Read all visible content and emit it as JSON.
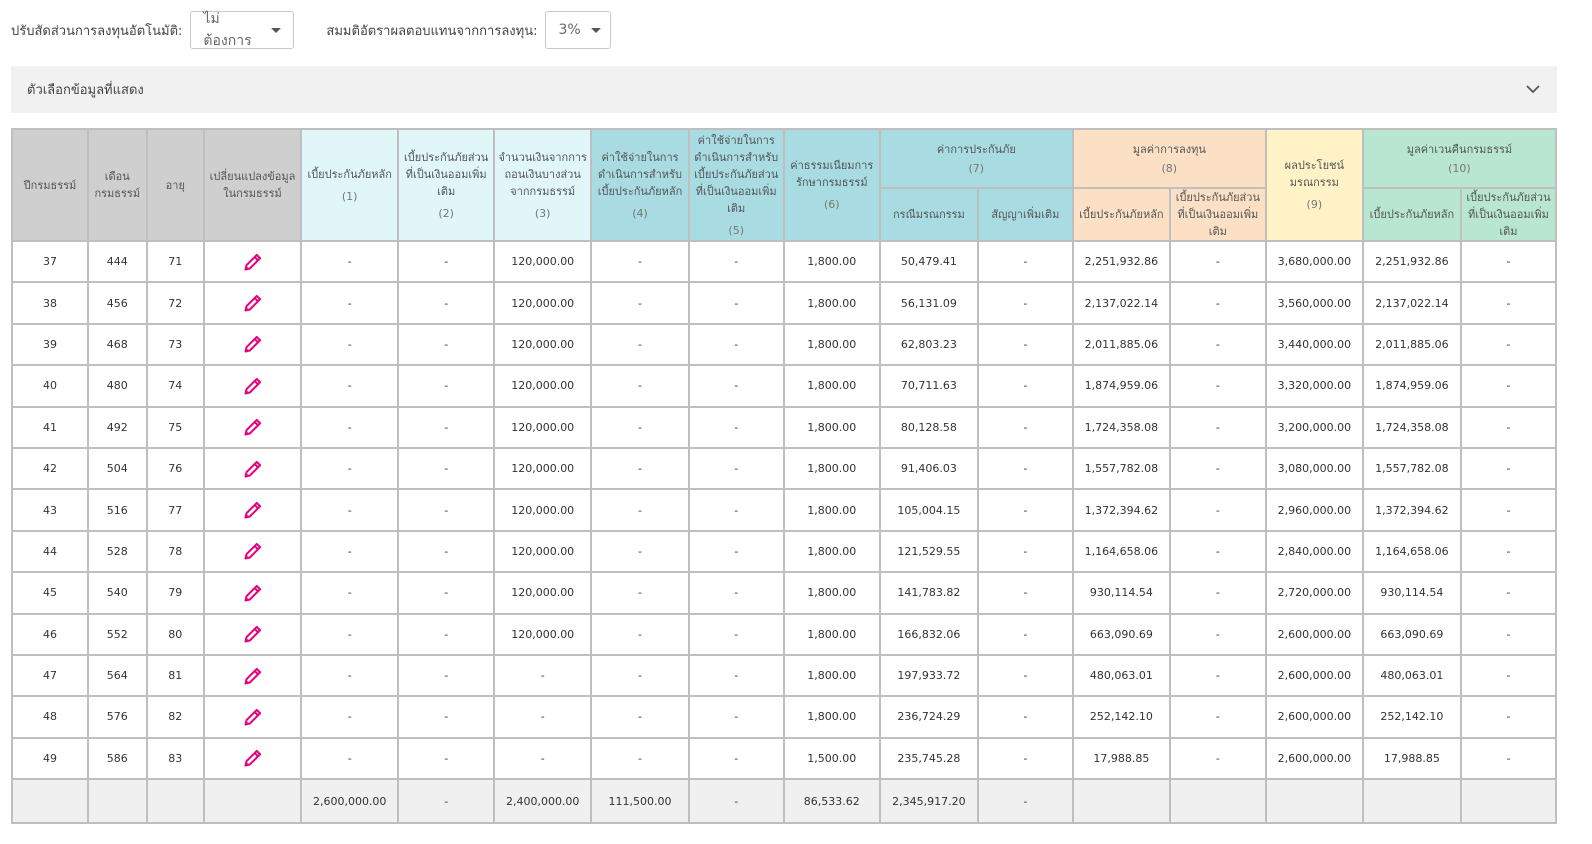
{
  "controls": {
    "auto_rebalance_label": "ปรับสัดส่วนการลงทุนอัตโนมัติ:",
    "auto_rebalance_value": "ไม่ต้องการ",
    "return_rate_label": "สมมติอัตราผลตอบแทนจากการลงทุน:",
    "return_rate_value": "3%"
  },
  "display_options": {
    "title": "ตัวเลือกข้อมูลที่แสดง"
  },
  "colors": {
    "pencil": "#e6007e",
    "header_grey": "#cfcfcf",
    "header_light_cyan": "#e0f6f8",
    "header_cyan": "#a8dce2",
    "header_peach": "#fbe0c6",
    "header_yellow": "#fff2c6",
    "header_green": "#b8e6d0"
  },
  "table": {
    "headers": {
      "policy_year": "ปีกรมธรรม์",
      "policy_month": "เดือนกรมธรรม์",
      "age": "อายุ",
      "change": "เปลี่ยนแปลงข้อมูลในกรมธรรม์",
      "c1": "เบี้ยประกันภัยหลัก",
      "c1_num": "(1)",
      "c2": "เบี้ยประกันภัยส่วนที่เป็นเงินออมเพิ่มเติม",
      "c2_num": "(2)",
      "c3": "จำนวนเงินจากการถอนเงินบางส่วนจากกรมธรรม์",
      "c3_num": "(3)",
      "c4": "ค่าใช้จ่ายในการดำเนินการสำหรับเบี้ยประกันภัยหลัก",
      "c4_num": "(4)",
      "c5": "ค่าใช้จ่ายในการดำเนินการสำหรับเบี้ยประกันภัยส่วนที่เป็นเงินออมเพิ่มเติม",
      "c5_num": "(5)",
      "c6": "ค่าธรรมเนียมการรักษากรมธรรม์",
      "c6_num": "(6)",
      "c7": "ค่าการประกันภัย",
      "c7_num": "(7)",
      "c7a": "กรณีมรณกรรม",
      "c7b": "สัญญาเพิ่มเติม",
      "c8": "มูลค่าการลงทุน",
      "c8_num": "(8)",
      "c8a": "เบี้ยประกันภัยหลัก",
      "c8b": "เบี้ยประกันภัยส่วนที่เป็นเงินออมเพิ่มเติม",
      "c9": "ผลประโยชน์มรณกรรม",
      "c9_num": "(9)",
      "c10": "มูลค่าเวนคืนกรมธรรม์",
      "c10_num": "(10)",
      "c10a": "เบี้ยประกันภัยหลัก",
      "c10b": "เบี้ยประกันภัยส่วนที่เป็นเงินออมเพิ่มเติม"
    },
    "rows": [
      [
        "37",
        "444",
        "71",
        "-",
        "-",
        "120,000.00",
        "-",
        "-",
        "1,800.00",
        "50,479.41",
        "-",
        "2,251,932.86",
        "-",
        "3,680,000.00",
        "2,251,932.86",
        "-"
      ],
      [
        "38",
        "456",
        "72",
        "-",
        "-",
        "120,000.00",
        "-",
        "-",
        "1,800.00",
        "56,131.09",
        "-",
        "2,137,022.14",
        "-",
        "3,560,000.00",
        "2,137,022.14",
        "-"
      ],
      [
        "39",
        "468",
        "73",
        "-",
        "-",
        "120,000.00",
        "-",
        "-",
        "1,800.00",
        "62,803.23",
        "-",
        "2,011,885.06",
        "-",
        "3,440,000.00",
        "2,011,885.06",
        "-"
      ],
      [
        "40",
        "480",
        "74",
        "-",
        "-",
        "120,000.00",
        "-",
        "-",
        "1,800.00",
        "70,711.63",
        "-",
        "1,874,959.06",
        "-",
        "3,320,000.00",
        "1,874,959.06",
        "-"
      ],
      [
        "41",
        "492",
        "75",
        "-",
        "-",
        "120,000.00",
        "-",
        "-",
        "1,800.00",
        "80,128.58",
        "-",
        "1,724,358.08",
        "-",
        "3,200,000.00",
        "1,724,358.08",
        "-"
      ],
      [
        "42",
        "504",
        "76",
        "-",
        "-",
        "120,000.00",
        "-",
        "-",
        "1,800.00",
        "91,406.03",
        "-",
        "1,557,782.08",
        "-",
        "3,080,000.00",
        "1,557,782.08",
        "-"
      ],
      [
        "43",
        "516",
        "77",
        "-",
        "-",
        "120,000.00",
        "-",
        "-",
        "1,800.00",
        "105,004.15",
        "-",
        "1,372,394.62",
        "-",
        "2,960,000.00",
        "1,372,394.62",
        "-"
      ],
      [
        "44",
        "528",
        "78",
        "-",
        "-",
        "120,000.00",
        "-",
        "-",
        "1,800.00",
        "121,529.55",
        "-",
        "1,164,658.06",
        "-",
        "2,840,000.00",
        "1,164,658.06",
        "-"
      ],
      [
        "45",
        "540",
        "79",
        "-",
        "-",
        "120,000.00",
        "-",
        "-",
        "1,800.00",
        "141,783.82",
        "-",
        "930,114.54",
        "-",
        "2,720,000.00",
        "930,114.54",
        "-"
      ],
      [
        "46",
        "552",
        "80",
        "-",
        "-",
        "120,000.00",
        "-",
        "-",
        "1,800.00",
        "166,832.06",
        "-",
        "663,090.69",
        "-",
        "2,600,000.00",
        "663,090.69",
        "-"
      ],
      [
        "47",
        "564",
        "81",
        "-",
        "-",
        "-",
        "-",
        "-",
        "1,800.00",
        "197,933.72",
        "-",
        "480,063.01",
        "-",
        "2,600,000.00",
        "480,063.01",
        "-"
      ],
      [
        "48",
        "576",
        "82",
        "-",
        "-",
        "-",
        "-",
        "-",
        "1,800.00",
        "236,724.29",
        "-",
        "252,142.10",
        "-",
        "2,600,000.00",
        "252,142.10",
        "-"
      ],
      [
        "49",
        "586",
        "83",
        "-",
        "-",
        "-",
        "-",
        "-",
        "1,500.00",
        "235,745.28",
        "-",
        "17,988.85",
        "-",
        "2,600,000.00",
        "17,988.85",
        "-"
      ]
    ],
    "totals": [
      "",
      "",
      "",
      "",
      "2,600,000.00",
      "-",
      "2,400,000.00",
      "111,500.00",
      "-",
      "86,533.62",
      "2,345,917.20",
      "-",
      "",
      "",
      "",
      "",
      ""
    ]
  }
}
